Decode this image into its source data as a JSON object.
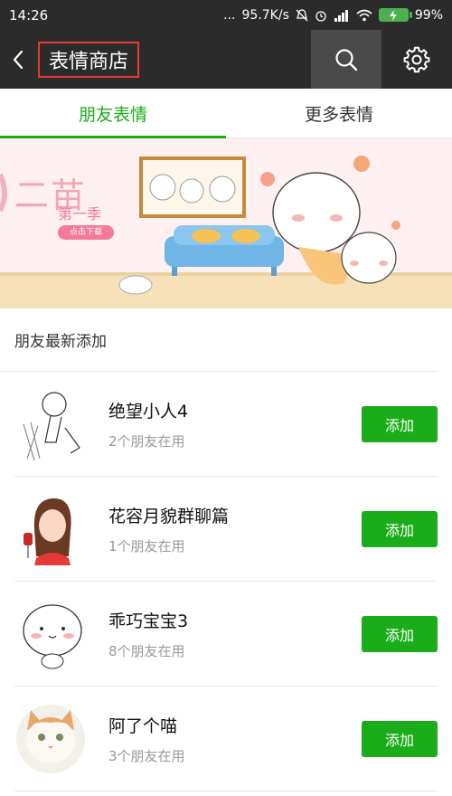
{
  "status_bar": {
    "time": "14:26",
    "signal_dots": "...",
    "network_speed": "95.7K/s",
    "battery": "99%"
  },
  "header": {
    "title": "表情商店",
    "back_icon": "chevron-left-icon",
    "search_icon": "search-icon",
    "settings_icon": "gear-icon"
  },
  "tabs": [
    {
      "label": "朋友表情",
      "active": true
    },
    {
      "label": "更多表情",
      "active": false
    }
  ],
  "banner": {
    "title": "二苗",
    "subtitle": "第一季",
    "tag": "点击下载"
  },
  "section": {
    "title": "朋友最新添加"
  },
  "items": [
    {
      "name": "绝望小人4",
      "sub": "2个朋友在用",
      "button": "添加"
    },
    {
      "name": "花容月貌群聊篇",
      "sub": "1个朋友在用",
      "button": "添加"
    },
    {
      "name": "乖巧宝宝3",
      "sub": "8个朋友在用",
      "button": "添加"
    },
    {
      "name": "阿了个喵",
      "sub": "3个朋友在用",
      "button": "添加"
    }
  ],
  "colors": {
    "accent": "#1aad19",
    "header_bg": "#2b2b2b",
    "highlight_border": "#e53935"
  }
}
